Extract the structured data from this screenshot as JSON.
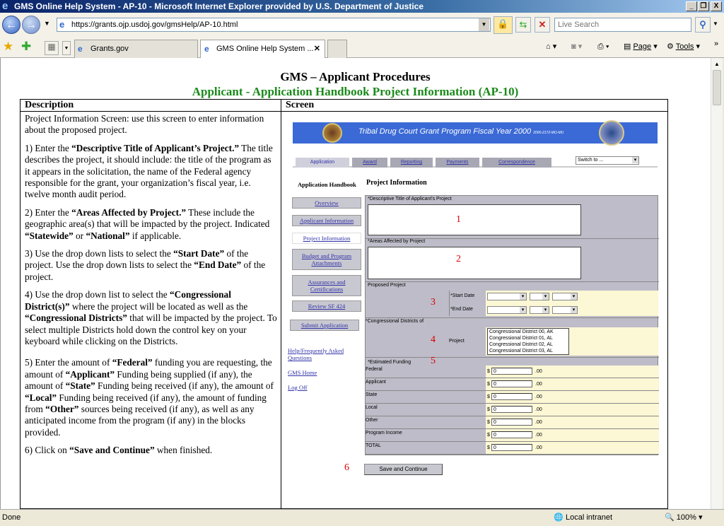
{
  "window": {
    "title": "GMS Online Help System - AP-10 - Microsoft Internet Explorer provided by U.S. Department of Justice",
    "minimize": "_",
    "restore": "❐",
    "close": "X"
  },
  "nav": {
    "url": "https://grants.ojp.usdoj.gov/gmsHelp/AP-10.html",
    "search_placeholder": "Live Search"
  },
  "tabs": [
    {
      "label": "Grants.gov"
    },
    {
      "label": "GMS Online Help System ..."
    }
  ],
  "tools": {
    "page": "Page",
    "tools": "Tools"
  },
  "status": {
    "text": "Done",
    "zone": "Local intranet",
    "zoom": "100%"
  },
  "page": {
    "title": "GMS – Applicant Procedures",
    "subtitle": "Applicant - Application Handbook Project Information (AP-10)",
    "col_description": "Description",
    "col_screen": "Screen",
    "description": {
      "intro": "Project Information Screen: use this screen to enter information about the proposed project.",
      "s1a": "1) Enter the ",
      "s1b": "“Descriptive Title of Applicant’s Project.”",
      "s1c": " The title describes the project, it should include: the title of the program as it appears in the solicitation, the name of the Federal agency responsible for the grant, your organization’s fiscal year, i.e. twelve month audit period.",
      "s2a": "2) Enter the ",
      "s2b": "“Areas Affected by Project.”",
      "s2c": "  These include the geographic area(s) that will be impacted by the project. Indicated ",
      "s2d": "“Statewide”",
      "s2e": " or ",
      "s2f": "“National”",
      "s2g": " if applicable.",
      "s3a": "3) Use the drop down lists to select the ",
      "s3b": "“Start Date”",
      "s3c": " of the project.  Use the drop down lists to select the ",
      "s3d": "“End Date”",
      "s3e": " of the project.",
      "s4a": "4) Use the drop down list to select the ",
      "s4b": "“Congressional District(s)”",
      "s4c": " where the project will be located as well as the ",
      "s4d": "“Congressional Districts”",
      "s4e": " that will be impacted by the project.  To select multiple Districts hold down the control key on your keyboard while clicking on the Districts.",
      "s5a": "5) Enter the amount of ",
      "s5b": "“Federal”",
      "s5c": " funding you are requesting, the amount of ",
      "s5d": "“Applicant”",
      "s5e": " Funding being supplied (if any), the amount of ",
      "s5f": "“State”",
      "s5g": " Funding being received (if any), the amount of ",
      "s5h": "“Local”",
      "s5i": " Funding being received (if any), the amount of funding from ",
      "s5j": "“Other”",
      "s5k": " sources being received (if any), as well as any anticipated income from the program (if any) in the blocks provided.",
      "s6a": "6) Click on ",
      "s6b": "“Save and Continue”",
      "s6c": " when finished."
    },
    "screen": {
      "banner": "Tribal Drug Court Grant Program Fiscal Year 2000",
      "banner_code": "2000-2172-MO-MU",
      "tabs": [
        "Application",
        "Award",
        "Reporting",
        "Payments",
        "Correspondence"
      ],
      "switch_to": "Switch to ...",
      "sidebar_title": "Application Handbook",
      "sidebar": [
        "Overview",
        "Applicant Information",
        "Project Information",
        "Budget and Program Attachments",
        "Assurances and Certifications",
        "Review SF 424",
        "Submit Application"
      ],
      "links": [
        "Help/Frequently Asked Questions",
        "GMS Home",
        "Log Off"
      ],
      "heading": "Project Information",
      "title_label": "*Descriptive Title of Applicant's Project",
      "areas_label": "*Areas Affected by Project",
      "proposed_label": "Proposed Project",
      "start_label": "*Start Date",
      "end_label": "*End Date",
      "districts_label": "*Congressional Districts of",
      "project_label": "Project",
      "districts": [
        "Congressional District 00, AK",
        "Congressional District 01, AL",
        "Congressional District 02, AL",
        "Congressional District 03, AL"
      ],
      "funding_label": "*Estimated Funding",
      "funding": [
        {
          "label": "Federal",
          "value": "0"
        },
        {
          "label": "Applicant",
          "value": "0"
        },
        {
          "label": "State",
          "value": "0"
        },
        {
          "label": "Local",
          "value": "0"
        },
        {
          "label": "Other",
          "value": "0"
        },
        {
          "label": "Program Income",
          "value": "0"
        },
        {
          "label": "TOTAL",
          "value": "0"
        }
      ],
      "currency": "$",
      "cents": ".00",
      "save_button": "Save and Continue",
      "markers": [
        "1",
        "2",
        "3",
        "4",
        "5",
        "6"
      ]
    }
  }
}
